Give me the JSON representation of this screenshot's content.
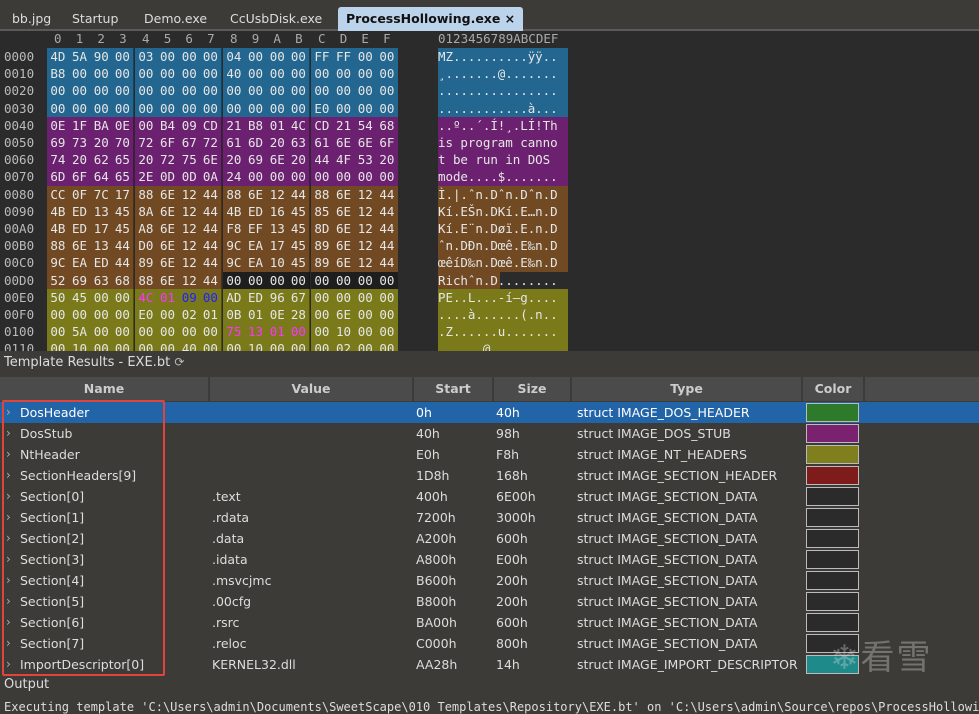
{
  "tabs": [
    {
      "label": "bb.jpg"
    },
    {
      "label": "Startup"
    },
    {
      "label": "Demo.exe"
    },
    {
      "label": "CcUsbDisk.exe"
    },
    {
      "label": "ProcessHollowing.exe ×",
      "active": true
    }
  ],
  "hex": {
    "column_header": [
      "0",
      "1",
      "2",
      "3",
      "4",
      "5",
      "6",
      "7",
      "8",
      "9",
      "A",
      "B",
      "C",
      "D",
      "E",
      "F"
    ],
    "ascii_header": "0123456789ABCDEF",
    "rows": [
      {
        "offset": "0000",
        "bytes": "4D 5A 90 00 03 00 00 00 04 00 00 00 FF FF 00 00",
        "ascii": "MZ..........ÿÿ.."
      },
      {
        "offset": "0010",
        "bytes": "B8 00 00 00 00 00 00 00 40 00 00 00 00 00 00 00",
        "ascii": "¸.......@......."
      },
      {
        "offset": "0020",
        "bytes": "00 00 00 00 00 00 00 00 00 00 00 00 00 00 00 00",
        "ascii": "................"
      },
      {
        "offset": "0030",
        "bytes": "00 00 00 00 00 00 00 00 00 00 00 00 E0 00 00 00",
        "ascii": "............à..."
      },
      {
        "offset": "0040",
        "bytes": "0E 1F BA 0E 00 B4 09 CD 21 B8 01 4C CD 21 54 68",
        "ascii": "..º..´.Í!¸.LÍ!Th"
      },
      {
        "offset": "0050",
        "bytes": "69 73 20 70 72 6F 67 72 61 6D 20 63 61 6E 6E 6F",
        "ascii": "is program canno"
      },
      {
        "offset": "0060",
        "bytes": "74 20 62 65 20 72 75 6E 20 69 6E 20 44 4F 53 20",
        "ascii": "t be run in DOS "
      },
      {
        "offset": "0070",
        "bytes": "6D 6F 64 65 2E 0D 0D 0A 24 00 00 00 00 00 00 00",
        "ascii": "mode....$......."
      },
      {
        "offset": "0080",
        "bytes": "CC 0F 7C 17 88 6E 12 44 88 6E 12 44 88 6E 12 44",
        "ascii": "Ì.|.ˆn.Dˆn.Dˆn.D"
      },
      {
        "offset": "0090",
        "bytes": "4B ED 13 45 8A 6E 12 44 4B ED 16 45 85 6E 12 44",
        "ascii": "Kí.EŠn.DKí.E…n.D"
      },
      {
        "offset": "00A0",
        "bytes": "4B ED 17 45 A8 6E 12 44 F8 EF 13 45 8D 6E 12 44",
        "ascii": "Kí.E¨n.Døï.E.n.D"
      },
      {
        "offset": "00B0",
        "bytes": "88 6E 13 44 D0 6E 12 44 9C EA 17 45 89 6E 12 44",
        "ascii": "ˆn.DÐn.Dœê.E‰n.D"
      },
      {
        "offset": "00C0",
        "bytes": "9C EA ED 44 89 6E 12 44 9C EA 10 45 89 6E 12 44",
        "ascii": "œêíD‰n.Dœê.E‰n.D"
      },
      {
        "offset": "00D0",
        "bytes": "52 69 63 68 88 6E 12 44 00 00 00 00 00 00 00 00",
        "ascii": "Richˆn.D........"
      },
      {
        "offset": "00E0",
        "bytes": "50 45 00 00 4C 01 09 00 AD ED 96 67 00 00 00 00",
        "ascii": "PE..L...-í–g...."
      },
      {
        "offset": "00F0",
        "bytes": "00 00 00 00 E0 00 02 01 0B 01 0E 28 00 6E 00 00",
        "ascii": "....à......(.n.."
      },
      {
        "offset": "0100",
        "bytes": "00 5A 00 00 00 00 00 00 75 13 01 00 00 10 00 00",
        "ascii": ".Z......u......."
      },
      {
        "offset": "0110",
        "bytes": "00 10 00 00 00 00 40 00 00 10 00 00 00 02 00 00",
        "ascii": "......@........."
      }
    ],
    "regions": [
      {
        "start": "0h",
        "end": "40h",
        "color": "#23668f"
      },
      {
        "start": "40h",
        "end": "80h",
        "color": "#6c2170"
      },
      {
        "start": "80h",
        "end": "D8h",
        "color": "#714a24"
      },
      {
        "start": "D8h",
        "end": "E0h",
        "color": "#1e1e1e"
      },
      {
        "start": "E0h",
        "end": "120h",
        "color": "#7a7a1b"
      }
    ],
    "highlights": [
      {
        "start": "E4h",
        "end": "E6h",
        "color": "#ff33ff"
      },
      {
        "start": "E6h",
        "end": "E8h",
        "color": "#2020ff"
      },
      {
        "start": "108h",
        "end": "10Ch",
        "color": "#ff33ff"
      }
    ]
  },
  "template_results": {
    "title": "Template Results - EXE.bt",
    "refresh_icon": "refresh-icon",
    "columns": [
      "Name",
      "Value",
      "Start",
      "Size",
      "Type",
      "Color"
    ],
    "rows": [
      {
        "name": "DosHeader",
        "value": "",
        "start": "0h",
        "size": "40h",
        "type": "struct IMAGE_DOS_HEADER",
        "color": "#2d7a2a",
        "selected": true
      },
      {
        "name": "DosStub",
        "value": "",
        "start": "40h",
        "size": "98h",
        "type": "struct IMAGE_DOS_STUB",
        "color": "#7a2170"
      },
      {
        "name": "NtHeader",
        "value": "",
        "start": "E0h",
        "size": "F8h",
        "type": "struct IMAGE_NT_HEADERS",
        "color": "#7f7f1e"
      },
      {
        "name": "SectionHeaders[9]",
        "value": "",
        "start": "1D8h",
        "size": "168h",
        "type": "struct IMAGE_SECTION_HEADER",
        "color": "#7e1b1b"
      },
      {
        "name": "Section[0]",
        "value": ".text",
        "start": "400h",
        "size": "6E00h",
        "type": "struct IMAGE_SECTION_DATA",
        "color": "#2b2b2b"
      },
      {
        "name": "Section[1]",
        "value": ".rdata",
        "start": "7200h",
        "size": "3000h",
        "type": "struct IMAGE_SECTION_DATA",
        "color": "#2b2b2b"
      },
      {
        "name": "Section[2]",
        "value": ".data",
        "start": "A200h",
        "size": "600h",
        "type": "struct IMAGE_SECTION_DATA",
        "color": "#2b2b2b"
      },
      {
        "name": "Section[3]",
        "value": ".idata",
        "start": "A800h",
        "size": "E00h",
        "type": "struct IMAGE_SECTION_DATA",
        "color": "#2b2b2b"
      },
      {
        "name": "Section[4]",
        "value": ".msvcjmc",
        "start": "B600h",
        "size": "200h",
        "type": "struct IMAGE_SECTION_DATA",
        "color": "#2b2b2b"
      },
      {
        "name": "Section[5]",
        "value": ".00cfg",
        "start": "B800h",
        "size": "200h",
        "type": "struct IMAGE_SECTION_DATA",
        "color": "#2b2b2b"
      },
      {
        "name": "Section[6]",
        "value": ".rsrc",
        "start": "BA00h",
        "size": "600h",
        "type": "struct IMAGE_SECTION_DATA",
        "color": "#2b2b2b"
      },
      {
        "name": "Section[7]",
        "value": ".reloc",
        "start": "C000h",
        "size": "800h",
        "type": "struct IMAGE_SECTION_DATA",
        "color": "#2b2b2b"
      },
      {
        "name": "ImportDescriptor[0]",
        "value": "KERNEL32.dll",
        "start": "AA28h",
        "size": "14h",
        "type": "struct IMAGE_IMPORT_DESCRIPTOR",
        "color": "#1f8a8a"
      }
    ]
  },
  "output": {
    "title": "Output",
    "line": "Executing template 'C:\\Users\\admin\\Documents\\SweetScape\\010 Templates\\Repository\\EXE.bt' on 'C:\\Users\\admin\\Source\\repos\\ProcessHollowing\\D"
  },
  "watermark": "看雪"
}
